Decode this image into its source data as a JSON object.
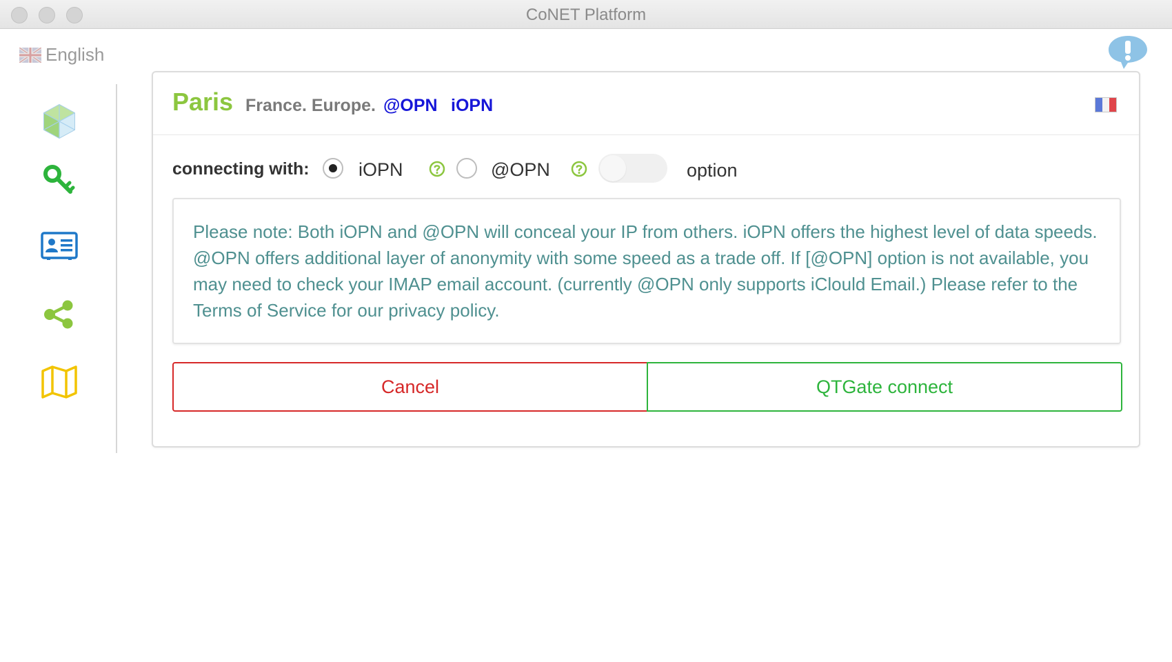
{
  "window": {
    "title": "CoNET Platform"
  },
  "language": {
    "label": "English",
    "flag_icon": "uk-flag-icon"
  },
  "sidebar": {
    "items": [
      {
        "icon": "cube-icon",
        "color": "#8cc63f"
      },
      {
        "icon": "key-icon",
        "color": "#2db43c"
      },
      {
        "icon": "id-card-icon",
        "color": "#1f78c8"
      },
      {
        "icon": "share-icon",
        "color": "#8cc63f"
      },
      {
        "icon": "map-icon",
        "color": "#f2c400"
      }
    ]
  },
  "card": {
    "city": "Paris",
    "region": "France. Europe.",
    "tags": [
      "@OPN",
      "iOPN"
    ],
    "flag_icon": "france-flag-icon",
    "connecting_label": "connecting with:",
    "options": [
      {
        "label": "iOPN",
        "selected": true
      },
      {
        "label": "@OPN",
        "selected": false
      }
    ],
    "toggle_label": "option",
    "toggle_on": false,
    "note": "Please note: Both iOPN and @OPN will conceal your IP from others. iOPN offers the highest level of data speeds. @OPN offers additional layer of anonymity with some speed as a trade off. If [@OPN] option is not available, you may need to check your IMAP email account. (currently @OPN only supports iClould Email.) Please refer to the Terms of Service for our privacy policy.",
    "cancel_label": "Cancel",
    "connect_label": "QTGate connect"
  },
  "colors": {
    "accent_green": "#8cc63f",
    "link_blue": "#1616d8",
    "note_text": "#4f9090",
    "cancel_red": "#d62828",
    "connect_green": "#2db43c"
  }
}
